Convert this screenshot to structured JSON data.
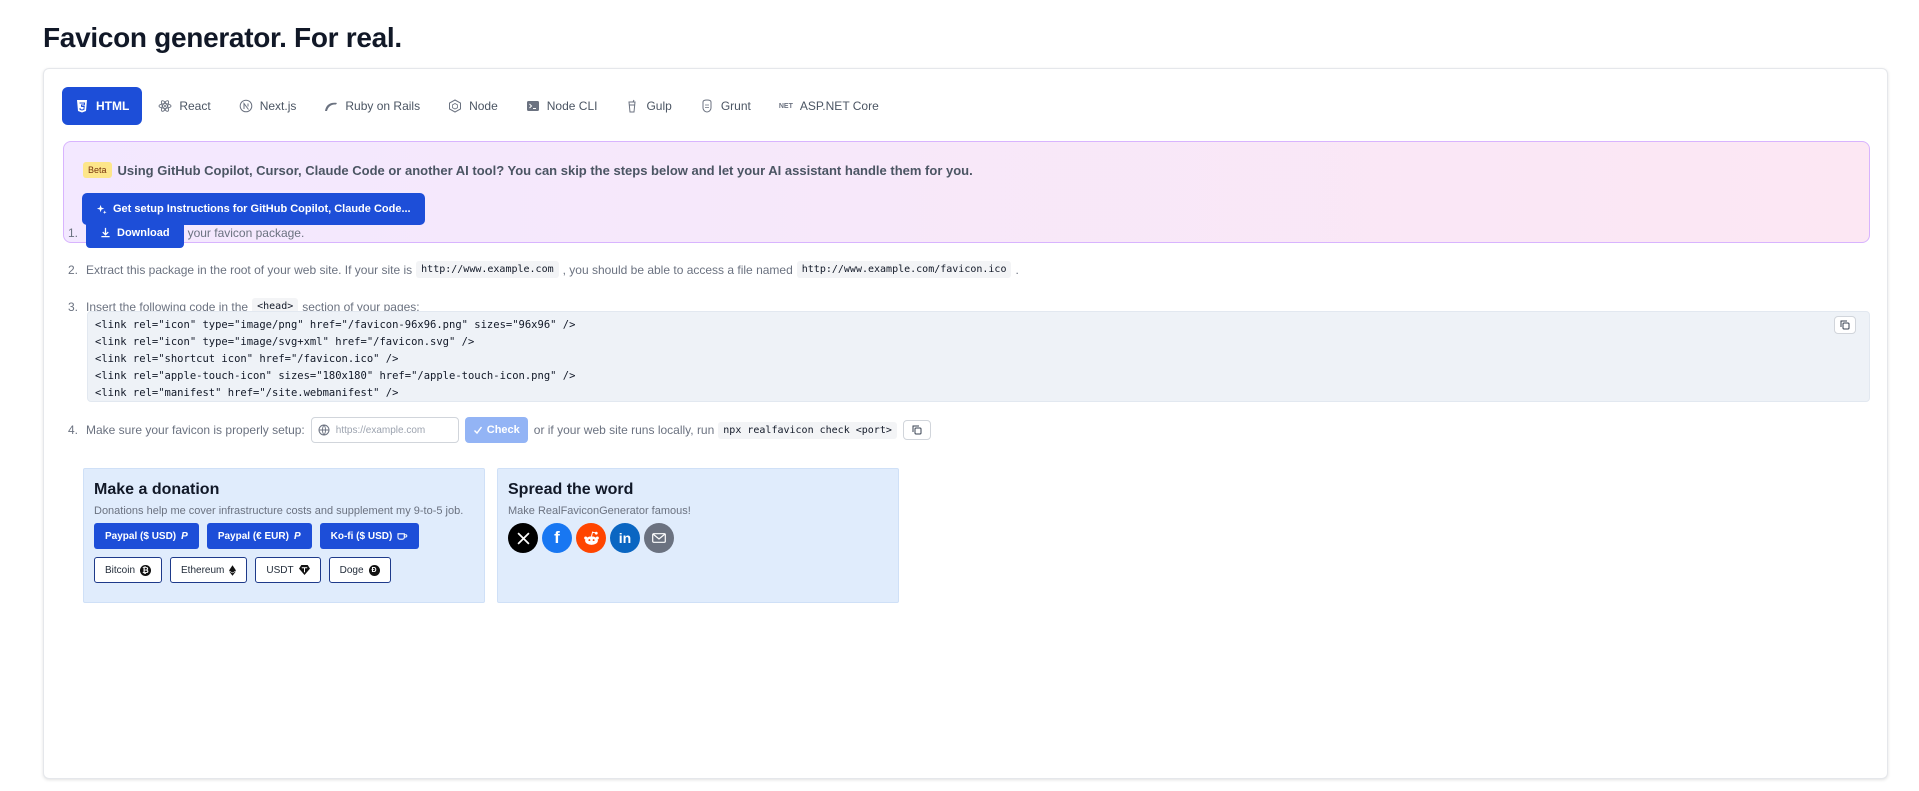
{
  "title": "Favicon generator. For real.",
  "tabs": [
    {
      "label": "HTML",
      "icon": "html5-icon",
      "active": true
    },
    {
      "label": "React",
      "icon": "react-icon"
    },
    {
      "label": "Next.js",
      "icon": "nextjs-icon"
    },
    {
      "label": "Ruby on Rails",
      "icon": "rails-icon"
    },
    {
      "label": "Node",
      "icon": "node-icon"
    },
    {
      "label": "Node CLI",
      "icon": "terminal-icon"
    },
    {
      "label": "Gulp",
      "icon": "gulp-icon"
    },
    {
      "label": "Grunt",
      "icon": "grunt-icon"
    },
    {
      "label": "ASP.NET Core",
      "icon": "dotnet-icon",
      "icon_text": "NET"
    }
  ],
  "ai_banner": {
    "badge": "Beta",
    "text": "Using GitHub Copilot, Cursor, Claude Code or another AI tool? You can skip the steps below and let your AI assistant handle them for you.",
    "button": "Get setup Instructions for GitHub Copilot, Claude Code..."
  },
  "steps": {
    "s1": {
      "num": "1.",
      "button": "Download",
      "text": "your favicon package."
    },
    "s2": {
      "num": "2.",
      "text_a": "Extract this package in the root of your web site. If your site is",
      "code_a": "http://www.example.com",
      "text_b": ", you should be able to access a file named",
      "code_b": "http://www.example.com/favicon.ico",
      "text_c": "."
    },
    "s3": {
      "num": "3.",
      "text_a": "Insert the following code in the",
      "code": "<head>",
      "text_b": "section of your pages:"
    },
    "s4": {
      "num": "4.",
      "text_a": "Make sure your favicon is properly setup:",
      "placeholder": "https://example.com",
      "check": "Check",
      "text_b": "or if your web site runs locally, run",
      "code": "npx realfavicon check <port>"
    }
  },
  "code_lines": [
    "<link rel=\"icon\" type=\"image/png\" href=\"/favicon-96x96.png\" sizes=\"96x96\" />",
    "<link rel=\"icon\" type=\"image/svg+xml\" href=\"/favicon.svg\" />",
    "<link rel=\"shortcut icon\" href=\"/favicon.ico\" />",
    "<link rel=\"apple-touch-icon\" sizes=\"180x180\" href=\"/apple-touch-icon.png\" />",
    "<link rel=\"manifest\" href=\"/site.webmanifest\" />"
  ],
  "donation": {
    "title": "Make a donation",
    "text": "Donations help me cover infrastructure costs and supplement my 9-to-5 job.",
    "primary": [
      {
        "label": "Paypal ($ USD)",
        "icon": "paypal-icon"
      },
      {
        "label": "Paypal (€ EUR)",
        "icon": "paypal-icon"
      },
      {
        "label": "Ko-fi ($ USD)",
        "icon": "coffee-icon"
      }
    ],
    "crypto": [
      {
        "label": "Bitcoin",
        "icon": "bitcoin-icon"
      },
      {
        "label": "Ethereum",
        "icon": "ethereum-icon"
      },
      {
        "label": "USDT",
        "icon": "tether-icon"
      },
      {
        "label": "Doge",
        "icon": "dogecoin-icon"
      }
    ]
  },
  "spread": {
    "title": "Spread the word",
    "text": "Make RealFaviconGenerator famous!",
    "socials": [
      {
        "name": "x-icon",
        "color": "#000000"
      },
      {
        "name": "facebook-icon",
        "color": "#1877f2"
      },
      {
        "name": "reddit-icon",
        "color": "#ff4500"
      },
      {
        "name": "linkedin-icon",
        "color": "#0a66c2"
      },
      {
        "name": "email-icon",
        "color": "#6b7280"
      }
    ]
  },
  "colors": {
    "accent": "#1d4ed8",
    "check_disabled": "#93b4f5",
    "panel_bg": "#e0ecfc"
  }
}
